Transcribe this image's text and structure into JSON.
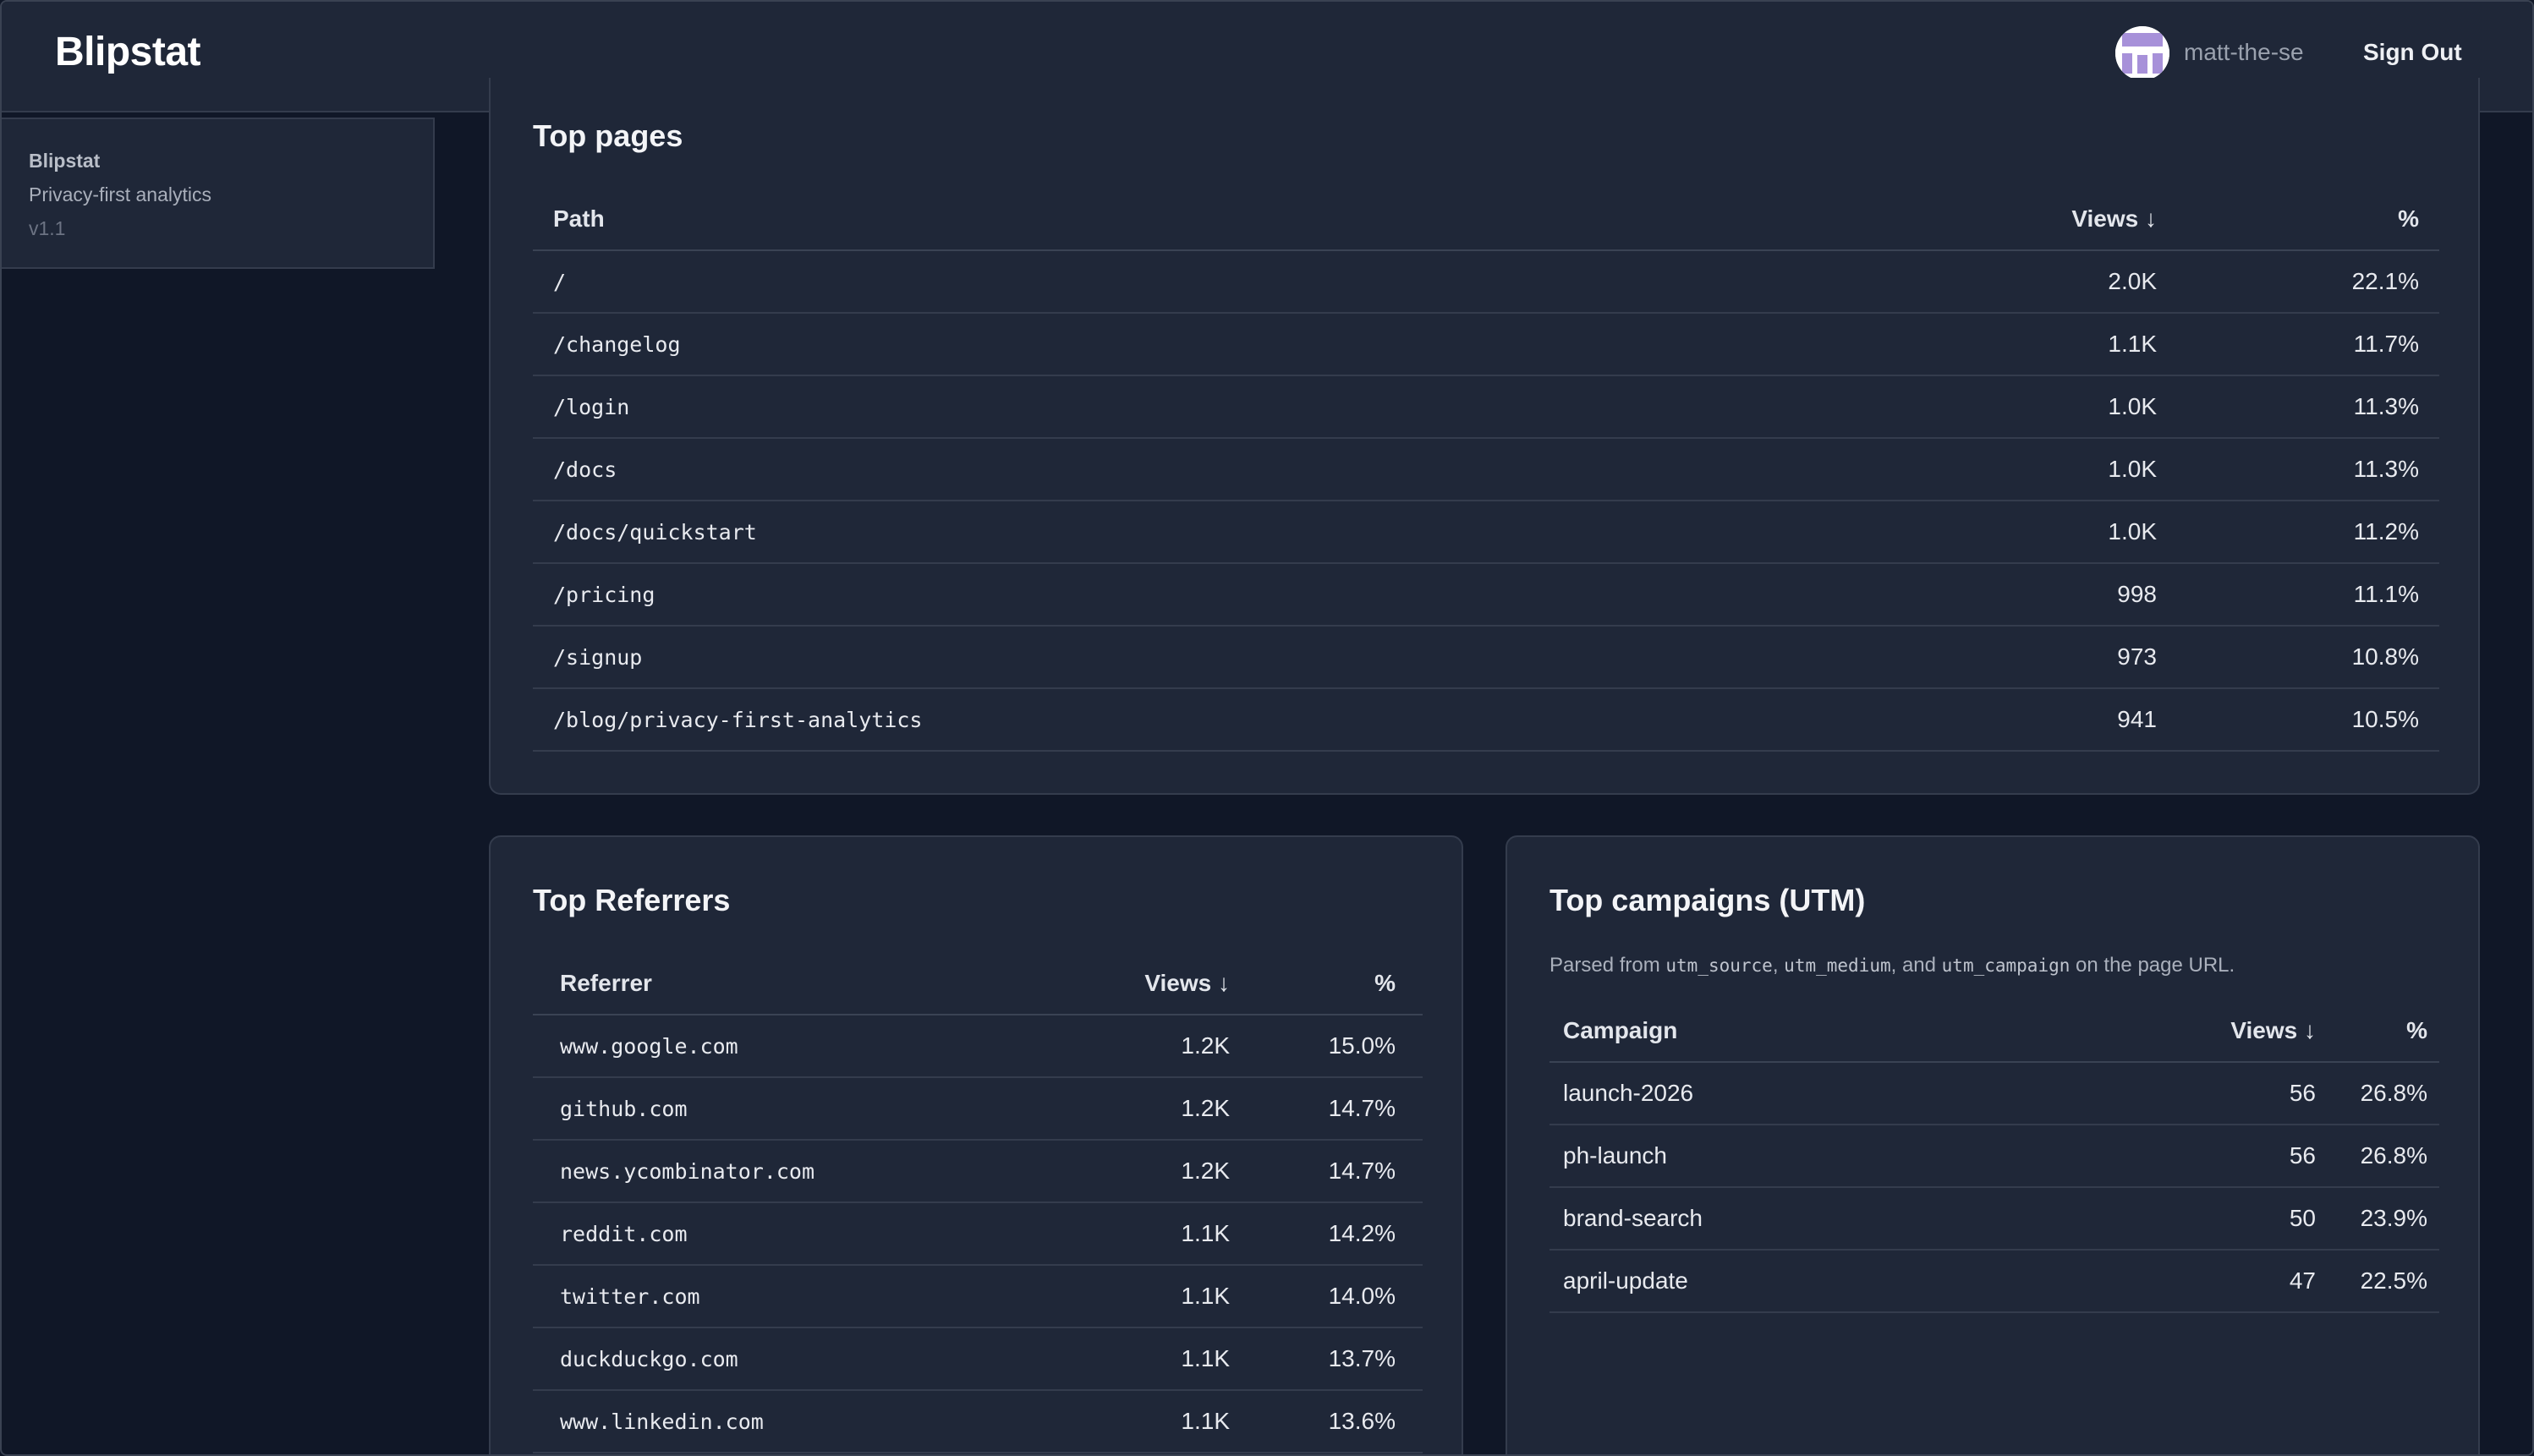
{
  "header": {
    "brand": "Blipstat",
    "username": "matt-the-se",
    "signout_label": "Sign Out"
  },
  "sidebar": {
    "name": "Blipstat",
    "tagline": "Privacy-first analytics",
    "version": "v1.1"
  },
  "top_pages": {
    "title": "Top pages",
    "columns": {
      "path": "Path",
      "views": "Views ↓",
      "pct": "%"
    },
    "rows": [
      {
        "path": "/",
        "views": "2.0K",
        "pct": "22.1%"
      },
      {
        "path": "/changelog",
        "views": "1.1K",
        "pct": "11.7%"
      },
      {
        "path": "/login",
        "views": "1.0K",
        "pct": "11.3%"
      },
      {
        "path": "/docs",
        "views": "1.0K",
        "pct": "11.3%"
      },
      {
        "path": "/docs/quickstart",
        "views": "1.0K",
        "pct": "11.2%"
      },
      {
        "path": "/pricing",
        "views": "998",
        "pct": "11.1%"
      },
      {
        "path": "/signup",
        "views": "973",
        "pct": "10.8%"
      },
      {
        "path": "/blog/privacy-first-analytics",
        "views": "941",
        "pct": "10.5%"
      }
    ]
  },
  "top_referrers": {
    "title": "Top Referrers",
    "columns": {
      "referrer": "Referrer",
      "views": "Views ↓",
      "pct": "%"
    },
    "rows": [
      {
        "referrer": "www.google.com",
        "views": "1.2K",
        "pct": "15.0%"
      },
      {
        "referrer": "github.com",
        "views": "1.2K",
        "pct": "14.7%"
      },
      {
        "referrer": "news.ycombinator.com",
        "views": "1.2K",
        "pct": "14.7%"
      },
      {
        "referrer": "reddit.com",
        "views": "1.1K",
        "pct": "14.2%"
      },
      {
        "referrer": "twitter.com",
        "views": "1.1K",
        "pct": "14.0%"
      },
      {
        "referrer": "duckduckgo.com",
        "views": "1.1K",
        "pct": "13.7%"
      },
      {
        "referrer": "www.linkedin.com",
        "views": "1.1K",
        "pct": "13.6%"
      }
    ]
  },
  "top_campaigns": {
    "title": "Top campaigns (UTM)",
    "note": {
      "prefix": "Parsed from ",
      "code1": "utm_source",
      "sep1": ", ",
      "code2": "utm_medium",
      "sep2": ", and ",
      "code3": "utm_campaign",
      "suffix": " on the page URL."
    },
    "columns": {
      "campaign": "Campaign",
      "views": "Views ↓",
      "pct": "%"
    },
    "rows": [
      {
        "campaign": "launch-2026",
        "views": "56",
        "pct": "26.8%"
      },
      {
        "campaign": "ph-launch",
        "views": "56",
        "pct": "26.8%"
      },
      {
        "campaign": "brand-search",
        "views": "50",
        "pct": "23.9%"
      },
      {
        "campaign": "april-update",
        "views": "47",
        "pct": "22.5%"
      }
    ]
  }
}
